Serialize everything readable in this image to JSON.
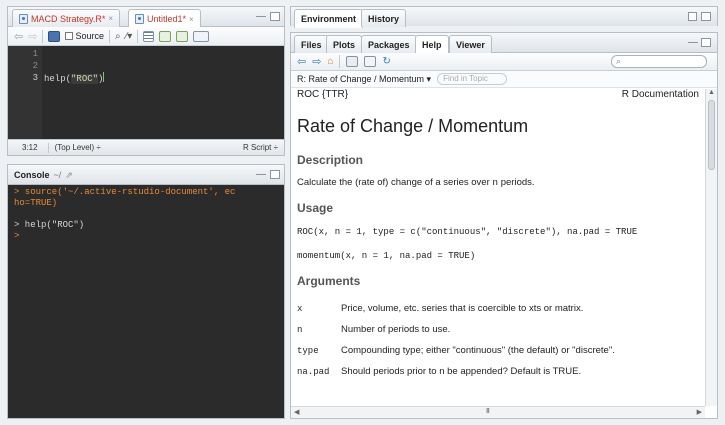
{
  "source_pane": {
    "tabs": [
      {
        "label": "MACD Strategy.R*",
        "close": "×"
      },
      {
        "label": "Untitled1*",
        "close": "×"
      }
    ],
    "source_on_save_label": "Source",
    "line_numbers": [
      "1",
      "2",
      "3"
    ],
    "code_line3_fn": "help(",
    "code_line3_str": "\"ROC\"",
    "code_line3_close": ")",
    "cursor_pos": "3:12",
    "scope": "(Top Level) ÷",
    "file_type": "R Script ÷"
  },
  "console_pane": {
    "title": "Console",
    "path": "~/",
    "lines": [
      {
        "text": "> source('~/.active-rstudio-document', ec",
        "color": "#e6893a"
      },
      {
        "text": "ho=TRUE)",
        "color": "#e6893a"
      },
      {
        "text": "",
        "color": "#d6d6d6"
      },
      {
        "text": "> help(\"ROC\")",
        "color": "#d6d6d6"
      },
      {
        "text": ">",
        "color": "#e6893a"
      }
    ]
  },
  "env_pane": {
    "tabs": [
      "Environment",
      "History"
    ]
  },
  "files_pane": {
    "tabs": [
      "Files",
      "Plots",
      "Packages",
      "Help",
      "Viewer"
    ],
    "active_tab": "Help",
    "search_placeholder": "",
    "topic_dropdown": "R: Rate of Change / Momentum ▾",
    "find_placeholder": "Find in Topic"
  },
  "help_doc": {
    "pkg_label": "ROC {TTR}",
    "doc_label": "R Documentation",
    "title": "Rate of Change / Momentum",
    "h_description": "Description",
    "description_a": "Calculate the (rate of) change of a series over ",
    "description_n": "n",
    "description_b": " periods.",
    "h_usage": "Usage",
    "usage_1": "ROC(x, n = 1, type = c(\"continuous\", \"discrete\"), na.pad = TRUE",
    "usage_2": "momentum(x, n = 1, na.pad = TRUE)",
    "h_arguments": "Arguments",
    "args": [
      {
        "name": "x",
        "desc": "Price, volume, etc. series that is coercible to xts or matrix."
      },
      {
        "name": "n",
        "desc": "Number of periods to use."
      },
      {
        "name": "type",
        "desc": "Compounding type; either \"continuous\" (the default) or \"discrete\"."
      },
      {
        "name": "na.pad",
        "desc": "Should periods prior to n be appended? Default is TRUE."
      }
    ],
    "hscroll_mark": "III"
  },
  "colors": {
    "orange": "#e6893a",
    "editor_bg": "#2b2b2b",
    "accent_blue": "#3c78c3"
  }
}
